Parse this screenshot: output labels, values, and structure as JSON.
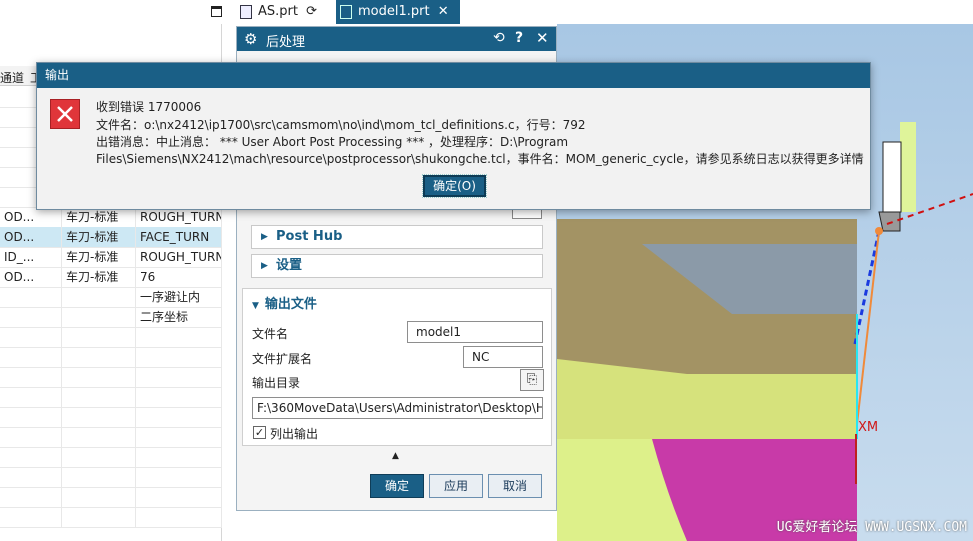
{
  "tabs": [
    {
      "label": "AS.prt",
      "active": false
    },
    {
      "label": "model1.prt",
      "active": true
    }
  ],
  "navigator": {
    "header": [
      "通道",
      "工"
    ],
    "rows": [
      {
        "c1": "",
        "c2": "",
        "c3": "",
        "selected": false
      },
      {
        "c1": "",
        "c2": "",
        "c3": "",
        "selected": false
      },
      {
        "c1": "",
        "c2": "",
        "c3": "",
        "selected": false
      },
      {
        "c1": "",
        "c2": "",
        "c3": "",
        "selected": false
      },
      {
        "c1": "",
        "c2": "",
        "c3": "",
        "selected": false
      },
      {
        "c1": "",
        "c2": "",
        "c3": "",
        "selected": false
      },
      {
        "c1": "OD...",
        "c2": "车刀-标准",
        "c3": "ROUGH_TURN",
        "selected": false
      },
      {
        "c1": "OD...",
        "c2": "车刀-标准",
        "c3": "FACE_TURN",
        "selected": true
      },
      {
        "c1": "ID_...",
        "c2": "车刀-标准",
        "c3": "ROUGH_TURN",
        "selected": false
      },
      {
        "c1": "OD...",
        "c2": "车刀-标准",
        "c3": "76",
        "selected": false
      },
      {
        "c1": "",
        "c2": "",
        "c3": "一序避让内",
        "selected": false
      },
      {
        "c1": "",
        "c2": "",
        "c3": "二序坐标",
        "selected": false
      },
      {
        "c1": "",
        "c2": "",
        "c3": "",
        "selected": false
      },
      {
        "c1": "",
        "c2": "",
        "c3": "",
        "selected": false
      },
      {
        "c1": "",
        "c2": "",
        "c3": "",
        "selected": false
      },
      {
        "c1": "",
        "c2": "",
        "c3": "",
        "selected": false
      },
      {
        "c1": "",
        "c2": "",
        "c3": "",
        "selected": false
      },
      {
        "c1": "",
        "c2": "",
        "c3": "",
        "selected": false
      },
      {
        "c1": "",
        "c2": "",
        "c3": "",
        "selected": false
      },
      {
        "c1": "",
        "c2": "",
        "c3": "",
        "selected": false
      },
      {
        "c1": "",
        "c2": "",
        "c3": "",
        "selected": false
      },
      {
        "c1": "",
        "c2": "",
        "c3": "",
        "selected": false
      }
    ]
  },
  "postprocess_dialog": {
    "title": "后处理",
    "sections": {
      "post_hub": "Post Hub",
      "settings": "设置",
      "output_file": "输出文件"
    },
    "file_name_label": "文件名",
    "file_name_value": "model1",
    "file_ext_label": "文件扩展名",
    "file_ext_value": "NC",
    "output_dir_label": "输出目录",
    "output_dir_value": "F:\\360MoveData\\Users\\Administrator\\Desktop\\H",
    "list_output_label": "列出输出",
    "list_output_checked": true,
    "buttons": {
      "ok": "确定",
      "apply": "应用",
      "cancel": "取消"
    }
  },
  "error_dialog": {
    "title": "输出",
    "line1": "收到错误 1770006",
    "line2": "文件名：o:\\nx2412\\ip1700\\src\\camsmom\\no\\ind\\mom_tcl_definitions.c，行号：792",
    "line3": "出错消息：中止消息： *** User Abort Post Processing *** ，处理程序：D:\\Program",
    "line4": "Files\\Siemens\\NX2412\\mach\\resource\\postprocessor\\shukongche.tcl，事件名：MOM_generic_cycle，请参见系统日志以获得更多详情",
    "ok": "确定(O)"
  },
  "viewport": {
    "axis_label": "XM",
    "watermark": "UG爱好者论坛 WWW.UGSNX.COM"
  },
  "colors": {
    "title_bar": "#1a5f86",
    "error_icon": "#e0353a",
    "selected_row": "#cde8f4"
  }
}
